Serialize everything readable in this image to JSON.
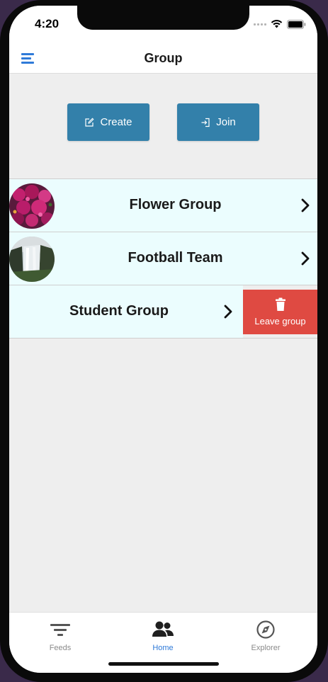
{
  "status_bar": {
    "time": "4:20"
  },
  "nav": {
    "title": "Group",
    "menu_icon": "hamburger-menu-icon"
  },
  "actions": {
    "create_label": "Create",
    "create_icon": "edit-icon",
    "join_label": "Join",
    "join_icon": "sign-in-icon",
    "button_color": "#3380aa"
  },
  "groups": [
    {
      "name": "Flower Group",
      "avatar": "flower-photo"
    },
    {
      "name": "Football Team",
      "avatar": "waterfall-photo"
    },
    {
      "name": "Student Group",
      "avatar": ""
    }
  ],
  "swipe_action": {
    "label": "Leave group",
    "icon": "trash-icon",
    "color": "#df4a42"
  },
  "tabs": [
    {
      "label": "Feeds",
      "icon": "filter-icon",
      "active": false
    },
    {
      "label": "Home",
      "icon": "people-icon",
      "active": true
    },
    {
      "label": "Explorer",
      "icon": "compass-icon",
      "active": false
    }
  ],
  "accent_color": "#2f7ad8",
  "row_background": "#ebfdfe"
}
